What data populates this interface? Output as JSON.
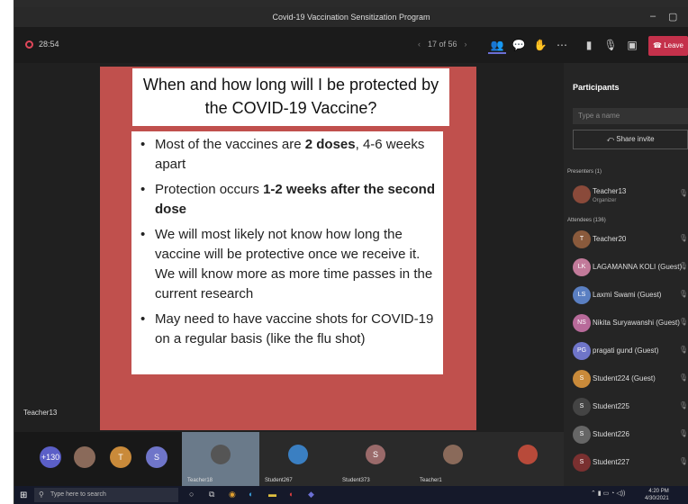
{
  "window": {
    "title": "Covid-19 Vaccination Sensitization Program",
    "minimize": "–",
    "maximize": "▢"
  },
  "toolbar": {
    "timer": "28:54",
    "page": "17 of 56",
    "prev": "‹",
    "next": "›",
    "leave_label": "Leave",
    "icons": [
      "people-icon",
      "chat-icon",
      "reactions-icon",
      "more-icon",
      "camera-off-icon",
      "mic-off-icon",
      "share-tray-icon"
    ]
  },
  "slide": {
    "title": "When and how long will I be protected by the COVID-19 Vaccine?",
    "bullets": [
      {
        "pre": "Most of the vaccines are ",
        "bold": "2 doses",
        "post": ", 4-6 weeks apart"
      },
      {
        "pre": "Protection occurs ",
        "bold": "1-2 weeks after the second dose",
        "post": ""
      },
      {
        "pre": "We will most likely not know how long the vaccine will be protective once we receive it. We will know more as more time passes in the current research",
        "bold": "",
        "post": ""
      },
      {
        "pre": "May need to have vaccine shots for COVID-19 on a regular basis (like the flu shot)",
        "bold": "",
        "post": ""
      }
    ],
    "presenter": "Teacher13"
  },
  "panel": {
    "title": "Participants",
    "search_placeholder": "Type a name",
    "share_invite": "Share invite",
    "presenters_header": "Presenters (1)",
    "presenter": {
      "name": "Teacher13",
      "role": "Organizer"
    },
    "attendees_header": "Attendees (136)",
    "attendees": [
      {
        "name": "Teacher20",
        "initials": "T",
        "color": "#8a5a3c"
      },
      {
        "name": "LAGAMANNA KOLI (Guest)",
        "initials": "LK",
        "color": "#c27a9a"
      },
      {
        "name": "Laxmi Swami (Guest)",
        "initials": "LS",
        "color": "#5a7fc2"
      },
      {
        "name": "Nikita Suryawanshi (Guest)",
        "initials": "NS",
        "color": "#b86a9a"
      },
      {
        "name": "pragati gund (Guest)",
        "initials": "PG",
        "color": "#6f75c9"
      },
      {
        "name": "Student224 (Guest)",
        "initials": "S",
        "color": "#c98a3a"
      },
      {
        "name": "Student225",
        "initials": "S",
        "color": "#444"
      },
      {
        "name": "Student226",
        "initials": "S",
        "color": "#666"
      },
      {
        "name": "Student227",
        "initials": "S",
        "color": "#7a3030"
      }
    ]
  },
  "strip": {
    "count": "+130",
    "circles": [
      {
        "text": "T",
        "color": "#c98a3a"
      },
      {
        "text": "S",
        "color": "#6f75c9"
      }
    ],
    "tiles": [
      {
        "label": "Teacher18",
        "initial": "",
        "color": "#555"
      },
      {
        "label": "Student267",
        "initial": "",
        "color": "#3a7fc2"
      },
      {
        "label": "Student373",
        "initial": "S",
        "color": "#9a6a6a"
      },
      {
        "label": "Teacher1",
        "initial": "",
        "color": "#8a6a5a"
      },
      {
        "label": "",
        "initial": "",
        "color": "#b84a3a"
      }
    ]
  },
  "taskbar": {
    "search_placeholder": "Type here to search",
    "time": "4:20 PM",
    "date": "4/30/2021"
  }
}
